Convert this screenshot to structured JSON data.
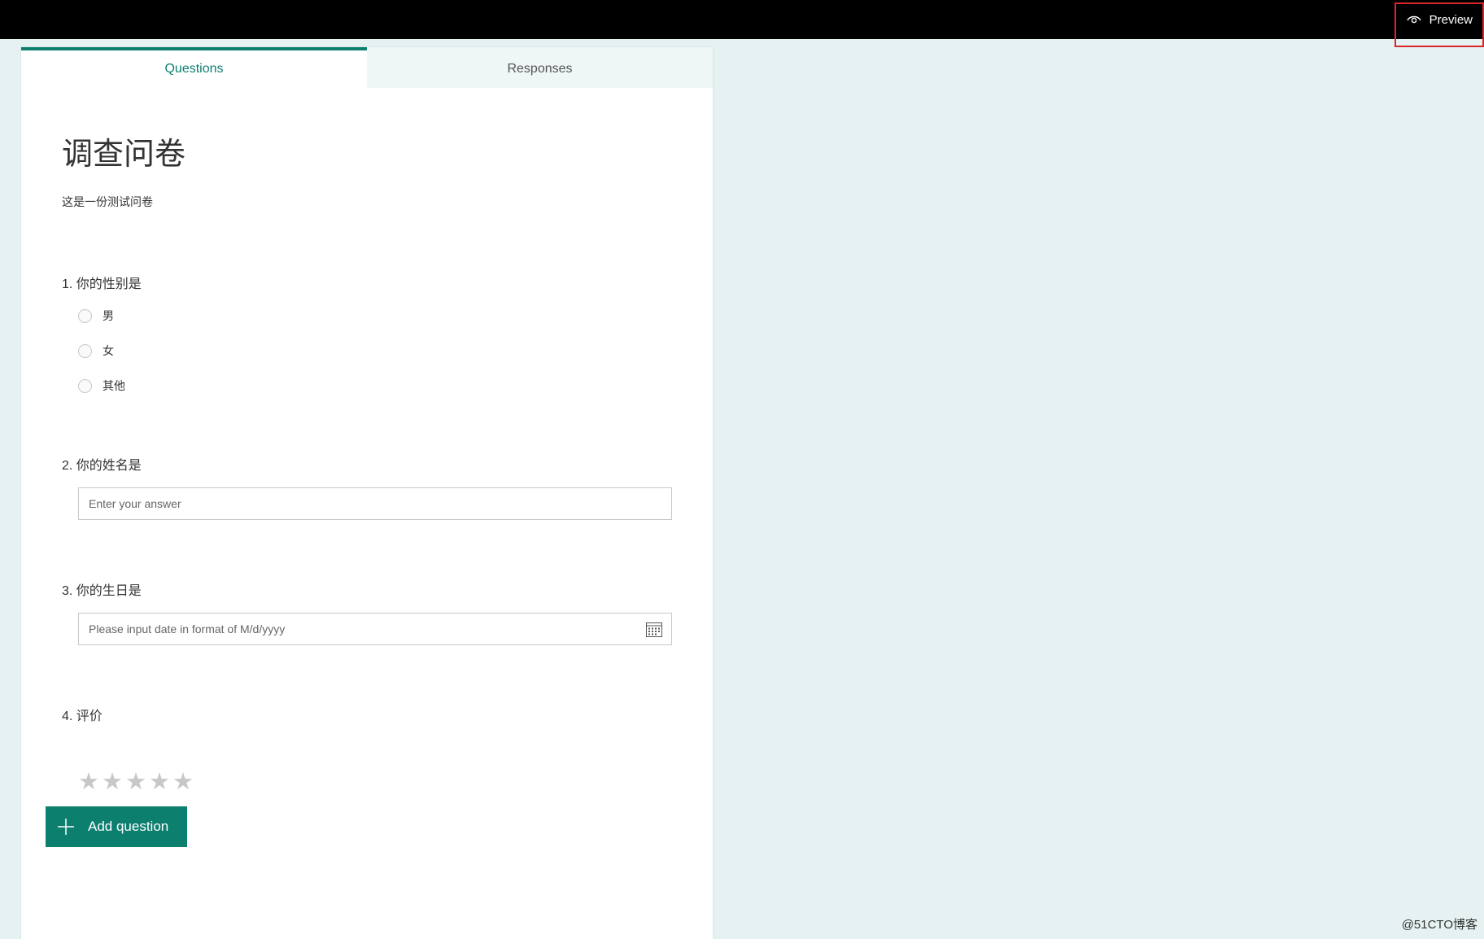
{
  "topbar": {
    "preview_label": "Preview",
    "preview_icon": "eye-icon"
  },
  "tabs": [
    {
      "label": "Questions",
      "active": true
    },
    {
      "label": "Responses",
      "active": false
    }
  ],
  "form": {
    "title": "调查问卷",
    "description": "这是一份测试问卷"
  },
  "questions": [
    {
      "title": "1. 你的性别是",
      "type": "choice",
      "options": [
        "男",
        "女",
        "其他"
      ]
    },
    {
      "title": "2. 你的姓名是",
      "type": "text",
      "placeholder": "Enter your answer"
    },
    {
      "title": "3. 你的生日是",
      "type": "date",
      "placeholder": "Please input date in format of M/d/yyyy",
      "icon": "calendar-icon"
    },
    {
      "title": "4. 评价",
      "type": "rating",
      "stars": [
        "★",
        "★",
        "★",
        "★",
        "★"
      ],
      "max": 5,
      "value": 0
    }
  ],
  "actions": {
    "add_question_label": "Add question",
    "add_question_icon": "plus-icon"
  },
  "watermark": "@51CTO博客",
  "colors": {
    "accent": "#0d7f6f",
    "topbar": "#000000",
    "background": "#e6f2f2",
    "annotation": "#d9252a",
    "star_empty": "#c8c8c8"
  }
}
